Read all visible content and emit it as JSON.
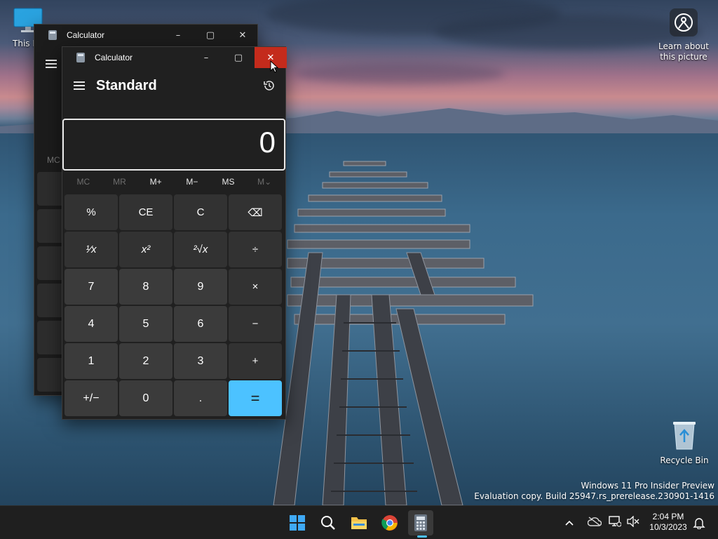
{
  "desktop": {
    "icons": [
      {
        "label": "This PC"
      },
      {
        "label": "Recycle Bin"
      }
    ],
    "learn_about": "Learn about this picture",
    "watermark_line1": "Windows 11 Pro Insider Preview",
    "watermark_line2": "Evaluation copy. Build 25947.rs_prerelease.230901-1416"
  },
  "back_window": {
    "title": "Calculator",
    "mem_label": "MC"
  },
  "calculator": {
    "title": "Calculator",
    "mode": "Standard",
    "display_value": "0",
    "memory": [
      "MC",
      "MR",
      "M+",
      "M−",
      "MS",
      "M⌄"
    ],
    "keys": [
      [
        "%",
        "CE",
        "C",
        "⌫"
      ],
      [
        "¹⁄x",
        "x²",
        "²√x",
        "÷"
      ],
      [
        "7",
        "8",
        "9",
        "×"
      ],
      [
        "4",
        "5",
        "6",
        "−"
      ],
      [
        "1",
        "2",
        "3",
        "+"
      ],
      [
        "+/−",
        "0",
        ".",
        "="
      ]
    ],
    "colors": {
      "accent": "#4cc2ff",
      "close": "#c42b1c"
    }
  },
  "taskbar": {
    "apps": [
      "start-icon",
      "search-icon",
      "file-explorer-icon",
      "chrome-icon",
      "calculator-icon"
    ],
    "time": "2:04 PM",
    "date": "10/3/2023"
  }
}
